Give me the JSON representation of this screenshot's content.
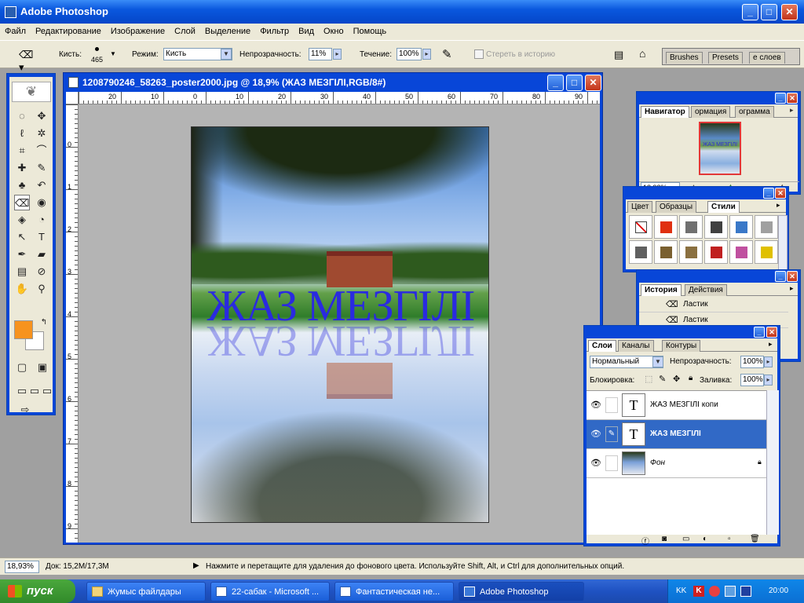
{
  "app": {
    "title": "Adobe Photoshop"
  },
  "menu": [
    "Файл",
    "Редактирование",
    "Изображение",
    "Слой",
    "Выделение",
    "Фильтр",
    "Вид",
    "Окно",
    "Помощь"
  ],
  "options": {
    "brush_label": "Кисть:",
    "brush_size": "465",
    "mode_label": "Режим:",
    "mode_value": "Кисть",
    "opacity_label": "Непрозрачность:",
    "opacity_value": "11%",
    "flow_label": "Течение:",
    "flow_value": "100%",
    "erase_history_label": "Стереть в историю",
    "well_tabs": [
      "Brushes",
      "Presets",
      "е слоев"
    ]
  },
  "document": {
    "title": "1208790246_58263_poster2000.jpg @ 18,9% (ЖАЗ МЕЗГІЛІ,RGB/8#)",
    "ruler_top": [
      "20",
      "10",
      "0",
      "10",
      "20",
      "30",
      "40",
      "50",
      "60",
      "70",
      "80",
      "90"
    ],
    "ruler_left": [
      "0",
      "1",
      "2",
      "3",
      "4",
      "5",
      "6",
      "7",
      "8",
      "9"
    ],
    "poster_text": "ЖАЗ МЕЗГІЛІ"
  },
  "toolbox": {
    "fg_color": "#f7931e",
    "bg_color": "#ffffff",
    "icons": [
      "marquee-icon",
      "move-icon",
      "lasso-icon",
      "magic-wand-icon",
      "crop-icon",
      "slice-icon",
      "healing-icon",
      "brush-icon",
      "stamp-icon",
      "history-brush-icon",
      "eraser-icon",
      "bucket-icon",
      "blur-icon",
      "dodge-icon",
      "path-select-icon",
      "type-icon",
      "pen-icon",
      "shape-icon",
      "notes-icon",
      "eyedropper-icon",
      "hand-icon",
      "zoom-icon"
    ]
  },
  "navigator": {
    "tabs": [
      "Навигатор",
      "ормация",
      "ограмма"
    ],
    "zoom": "18,93%"
  },
  "color_panel": {
    "tabs": [
      "Цвет",
      "Образцы",
      "Стили"
    ],
    "styles_row1": [
      "#ffffff",
      "#e03010",
      "#707070",
      "#404040",
      "#3a78c8",
      "#a0a0a0"
    ],
    "styles_row2": [
      "#606060",
      "#7a6030",
      "#8a7040",
      "#c02020",
      "#c050a0",
      "#e0c000"
    ]
  },
  "history": {
    "tabs": [
      "История",
      "Действия"
    ],
    "items": [
      "Ластик",
      "Ластик"
    ]
  },
  "layers": {
    "tabs": [
      "Слои",
      "Каналы",
      "Контуры"
    ],
    "blend_mode": "Нормальный",
    "opacity_label": "Непрозрачность:",
    "opacity_value": "100%",
    "lock_label": "Блокировка:",
    "fill_label": "Заливка:",
    "fill_value": "100%",
    "rows": [
      {
        "name": "ЖАЗ МЕЗГІЛІ копи",
        "thumb": "T"
      },
      {
        "name": "ЖАЗ МЕЗГІЛІ",
        "thumb": "T"
      },
      {
        "name": "Фон",
        "thumb": ""
      }
    ]
  },
  "status": {
    "zoom": "18,93%",
    "doc": "Док: 15,2M/17,3M",
    "hint": "Нажмите и перетащите для удаления до фонового цвета.  Используйте Shift, Alt, и Ctrl для дополнительных опций."
  },
  "taskbar": {
    "start": "пуск",
    "buttons": [
      "Жумыс файлдары",
      "22-сабак - Microsoft ...",
      "Фантастическая не...",
      "Adobe Photoshop"
    ],
    "lang": "KK",
    "clock": "20:00"
  }
}
